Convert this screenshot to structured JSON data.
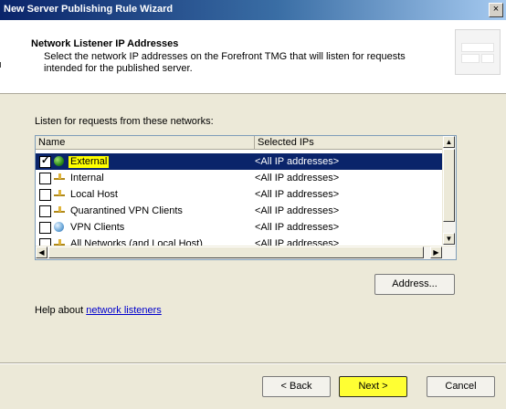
{
  "window": {
    "title": "New Server Publishing Rule Wizard",
    "close_glyph": "×"
  },
  "header": {
    "title": "Network Listener IP Addresses",
    "description": "Select the network IP addresses on the Forefront TMG that will listen for requests intended for the published server."
  },
  "listen_label": "Listen for requests from these networks:",
  "columns": {
    "name": "Name",
    "ips": "Selected IPs"
  },
  "rows": [
    {
      "name": "External",
      "ips": "<All IP addresses>",
      "checked": true,
      "selected": true,
      "icon": "globe-icon"
    },
    {
      "name": "Internal",
      "ips": "<All IP addresses>",
      "checked": false,
      "icon": "network-icon"
    },
    {
      "name": "Local Host",
      "ips": "<All IP addresses>",
      "checked": false,
      "icon": "network-icon"
    },
    {
      "name": "Quarantined VPN Clients",
      "ips": "<All IP addresses>",
      "checked": false,
      "icon": "network-icon"
    },
    {
      "name": "VPN Clients",
      "ips": "<All IP addresses>",
      "checked": false,
      "icon": "vpn-clients-icon"
    },
    {
      "name": "All Networks (and Local Host)",
      "ips": "<All IP addresses>",
      "checked": false,
      "icon": "network-icon"
    }
  ],
  "check_glyph": "✓",
  "address_button": "Address...",
  "help": {
    "prefix": "Help about ",
    "link": "network listeners"
  },
  "buttons": {
    "back": "< Back",
    "next": "Next >",
    "cancel": "Cancel"
  },
  "colors": {
    "selection": "#0a246a",
    "highlight": "#ffff00",
    "title_bar": "#0a246a"
  }
}
